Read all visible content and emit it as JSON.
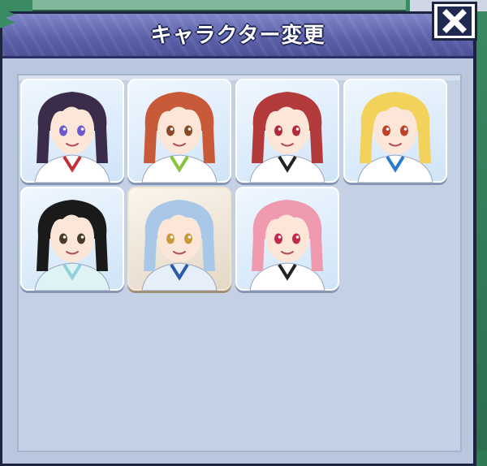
{
  "dialog": {
    "title": "キャラクター変更"
  },
  "characters": [
    {
      "id": "char-1",
      "hair_color": "#3a2c4a",
      "eye_color": "#6a5ad0",
      "outfit_color": "#ffffff",
      "accent_color": "#c2303a"
    },
    {
      "id": "char-2",
      "hair_color": "#c85a3a",
      "eye_color": "#8a4a2a",
      "outfit_color": "#ffffff",
      "accent_color": "#86c43a"
    },
    {
      "id": "char-3",
      "hair_color": "#b23a3a",
      "eye_color": "#b02a3a",
      "outfit_color": "#ffffff",
      "accent_color": "#222222"
    },
    {
      "id": "char-4",
      "hair_color": "#f2d25a",
      "eye_color": "#c0402a",
      "outfit_color": "#ffffff",
      "accent_color": "#2a7ad0"
    },
    {
      "id": "char-5",
      "hair_color": "#1a1a1a",
      "eye_color": "#4a3a2a",
      "outfit_color": "#dff2f4",
      "accent_color": "#8fd3d8"
    },
    {
      "id": "char-6",
      "hair_color": "#a9c8e8",
      "eye_color": "#c89a3a",
      "outfit_color": "#e6eef8",
      "accent_color": "#2a5ab0"
    },
    {
      "id": "char-7",
      "hair_color": "#f09ab0",
      "eye_color": "#c02a4a",
      "outfit_color": "#ffffff",
      "accent_color": "#222222"
    }
  ],
  "selected_character": "char-6",
  "colors": {
    "header": "#5a5fa8",
    "panel": "#b9c7de",
    "frame": "#1c2440"
  }
}
